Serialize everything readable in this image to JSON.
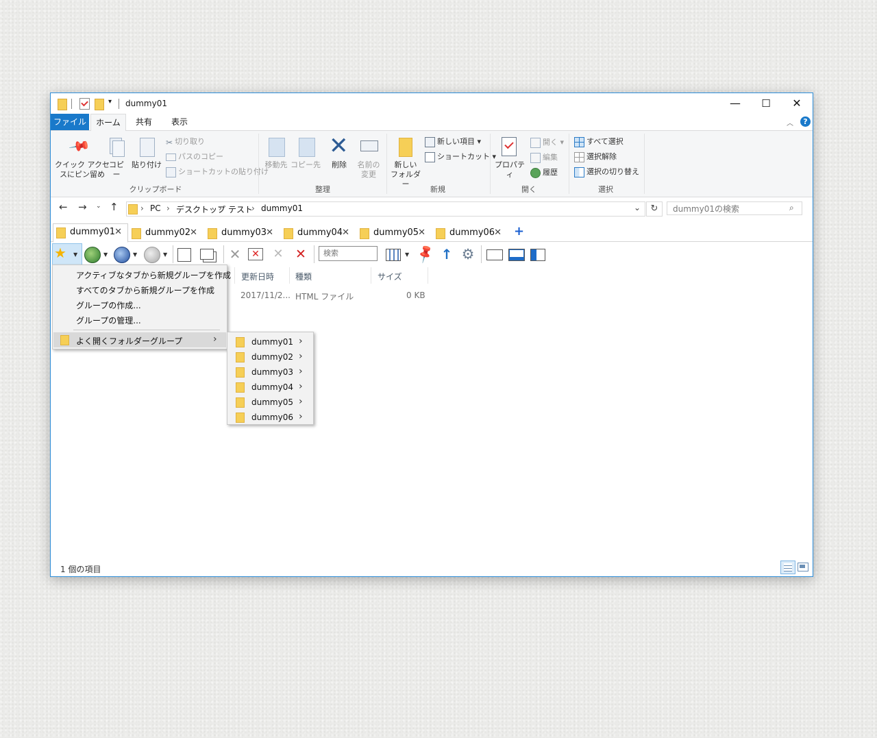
{
  "window": {
    "title": "dummy01",
    "controls": {
      "minimize": "—",
      "maximize": "☐",
      "close": "✕"
    }
  },
  "ribbon_tabs": [
    "ファイル",
    "ホーム",
    "共有",
    "表示"
  ],
  "ribbon": {
    "clipboard": {
      "pin_label_1": "クイック アクセ",
      "pin_label_2": "スにピン留め",
      "copy": "コピー",
      "paste": "貼り付け",
      "cut": "切り取り",
      "copy_path": "パスのコピー",
      "paste_shortcut": "ショートカットの貼り付け",
      "group": "クリップボード"
    },
    "organize": {
      "move_to": "移動先",
      "copy_to": "コピー先",
      "delete": "削除",
      "rename_1": "名前の",
      "rename_2": "変更",
      "group": "整理"
    },
    "new": {
      "new_folder_1": "新しい",
      "new_folder_2": "フォルダー",
      "new_item": "新しい項目",
      "shortcut": "ショートカット",
      "group": "新規"
    },
    "open": {
      "properties": "プロパティ",
      "open": "開く",
      "edit": "編集",
      "history": "履歴",
      "group": "開く"
    },
    "select": {
      "select_all": "すべて選択",
      "select_none": "選択解除",
      "invert": "選択の切り替え",
      "group": "選択"
    }
  },
  "address": {
    "crumbs": [
      "PC",
      "デスクトップ",
      "テスト",
      "dummy01"
    ],
    "search_placeholder": "dummy01の検索"
  },
  "tabs": [
    "dummy01",
    "dummy02",
    "dummy03",
    "dummy04",
    "dummy05",
    "dummy06"
  ],
  "toolbar": {
    "search_placeholder": "検索"
  },
  "columns": {
    "modified": "更新日時",
    "type": "種類",
    "size": "サイズ"
  },
  "file_row": {
    "modified": "2017/11/2...",
    "type": "HTML ファイル",
    "size": "0 KB"
  },
  "group_menu": {
    "items": [
      "アクティブなタブから新規グループを作成",
      "すべてのタブから新規グループを作成",
      "グループの作成...",
      "グループの管理..."
    ],
    "frequent": "よく開くフォルダーグループ"
  },
  "submenu": [
    "dummy01",
    "dummy02",
    "dummy03",
    "dummy04",
    "dummy05",
    "dummy06"
  ],
  "status": {
    "count": "1 個の項目"
  }
}
